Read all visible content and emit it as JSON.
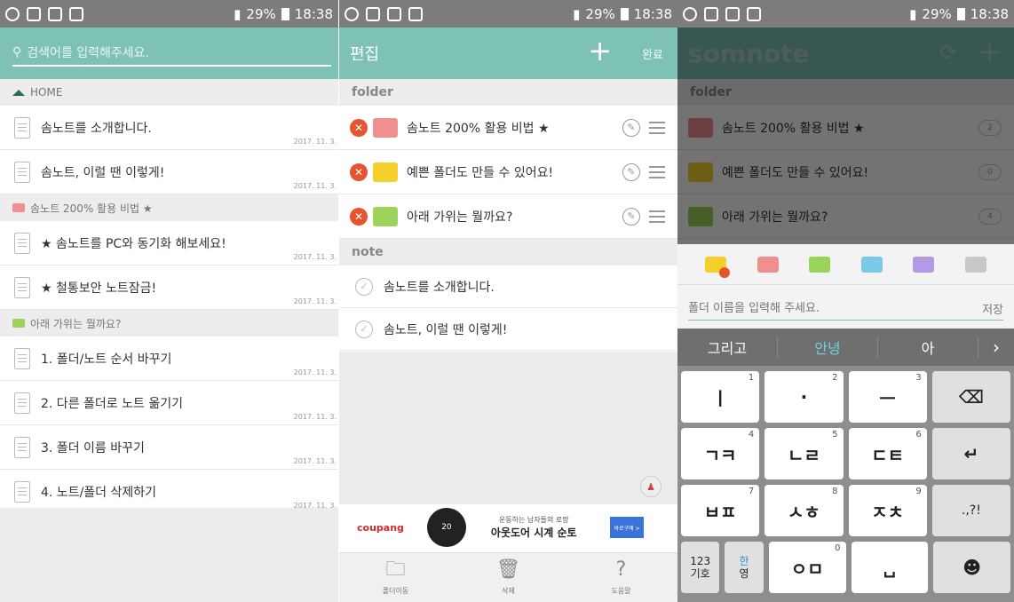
{
  "status": {
    "time": "18:38",
    "battery": "29%"
  },
  "p1": {
    "search_placeholder": "검색어를 입력해주세요.",
    "home_label": "HOME",
    "home_notes": [
      {
        "title": "솜노트를 소개합니다.",
        "date": "2017. 11. 3."
      },
      {
        "title": "솜노트, 이럴 땐 이렇게!",
        "date": "2017. 11. 3."
      }
    ],
    "folder1_label": "솜노트 200% 활용 비법 ★",
    "folder1_notes": [
      {
        "title": "★ 솜노트를 PC와 동기화 해보세요!",
        "date": "2017. 11. 3."
      },
      {
        "title": "★ 철통보안 노트잠금!",
        "date": "2017. 11. 3."
      }
    ],
    "folder3_label": "아래 가위는 뭘까요?",
    "folder3_notes": [
      {
        "title": "1. 폴더/노트 순서 바꾸기",
        "date": "2017. 11. 3."
      },
      {
        "title": "2. 다른 폴더로 노트 옮기기",
        "date": "2017. 11. 3."
      },
      {
        "title": "3. 폴더 이름 바꾸기",
        "date": "2017. 11. 3."
      },
      {
        "title": "4. 노트/폴더 삭제하기",
        "date": "2017. 11. 3."
      }
    ]
  },
  "p2": {
    "title": "편집",
    "add": "+",
    "done": "완료",
    "folder_header": "folder",
    "folders": [
      {
        "title": "솜노트 200% 활용 비법 ★",
        "color": "#ef8f8f"
      },
      {
        "title": "예쁜 폴더도 만들 수 있어요!",
        "color": "#f3d02a"
      },
      {
        "title": "아래 가위는 뭘까요?",
        "color": "#9bd45a"
      }
    ],
    "note_header": "note",
    "notes": [
      "솜노트를 소개합니다.",
      "솜노트, 이럴 땐 이렇게!"
    ],
    "ad": {
      "brand": "coupang",
      "watch": "20",
      "sub": "운동하는 남자들의 로망",
      "main": "아웃도어 시계 순토",
      "btn": "바로구매 >"
    },
    "tabs": [
      {
        "icon": "folder-move-icon",
        "label": "폴더이동"
      },
      {
        "icon": "trash-icon",
        "label": "삭제"
      },
      {
        "icon": "help-icon",
        "label": "도움말"
      }
    ]
  },
  "p3": {
    "logo": "somnote",
    "folder_header": "folder",
    "folders": [
      {
        "title": "솜노트 200% 활용 비법 ★",
        "count": "2",
        "color": "#ef8f8f"
      },
      {
        "title": "예쁜 폴더도 만들 수 있어요!",
        "count": "0",
        "color": "#f3d02a"
      },
      {
        "title": "아래 가위는 뭘까요?",
        "count": "4",
        "color": "#9bd45a"
      }
    ],
    "swatch_colors": [
      "#f3d02a",
      "#ef8f8f",
      "#9bd45a",
      "#7cc8e8",
      "#b29be6",
      "#c8c8c8"
    ],
    "name_placeholder": "폴더 이름을 입력해 주세요.",
    "save": "저장",
    "suggestions": [
      "그리고",
      "안녕",
      "아"
    ],
    "keys": [
      [
        {
          "l": "ㅣ",
          "s": "1"
        },
        {
          "l": "·",
          "s": "2"
        },
        {
          "l": "ㅡ",
          "s": "3"
        }
      ],
      [
        {
          "l": "ㄱㅋ",
          "s": "4"
        },
        {
          "l": "ㄴㄹ",
          "s": "5"
        },
        {
          "l": "ㄷㅌ",
          "s": "6"
        }
      ],
      [
        {
          "l": "ㅂㅍ",
          "s": "7"
        },
        {
          "l": "ㅅㅎ",
          "s": "8"
        },
        {
          "l": "ㅈㅊ",
          "s": "9"
        }
      ],
      [
        {
          "l": "ㅇㅁ",
          "s": "0"
        }
      ]
    ],
    "punct_key": ".,?!",
    "mode_key_1": "123",
    "mode_key_2": "기호",
    "lang_key_1": "한",
    "lang_key_2": "영"
  },
  "colors": {
    "accent": "#7ec2b6",
    "folder_red": "#ef8f8f",
    "folder_green": "#9bd45a"
  }
}
